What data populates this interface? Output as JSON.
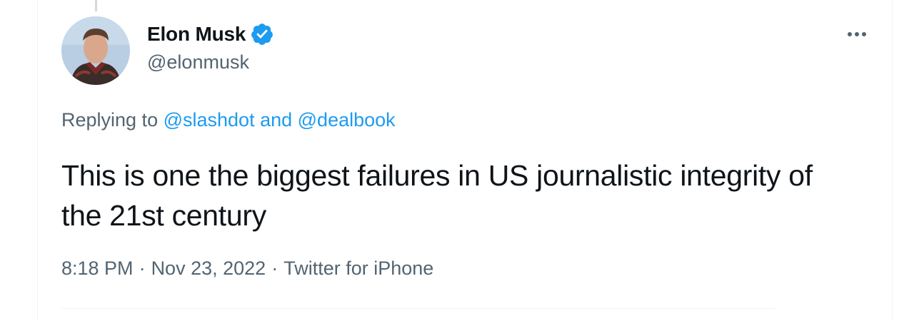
{
  "tweet": {
    "author": {
      "display_name": "Elon Musk",
      "handle": "@elonmusk",
      "verified": true
    },
    "replying_to": {
      "prefix": "Replying to ",
      "first": "@slashdot",
      "joiner": " and ",
      "second": "@dealbook"
    },
    "text": "This is one the biggest failures in US journalistic integrity of the 21st century",
    "time": "8:18 PM",
    "date": "Nov 23, 2022",
    "source": "Twitter for iPhone",
    "separator": "·"
  },
  "icons": {
    "verified": "verified-badge-icon",
    "more": "more-options-icon"
  },
  "colors": {
    "text_primary": "#0f1419",
    "text_secondary": "#536471",
    "link": "#1d9bf0",
    "verified": "#1d9bf0"
  }
}
